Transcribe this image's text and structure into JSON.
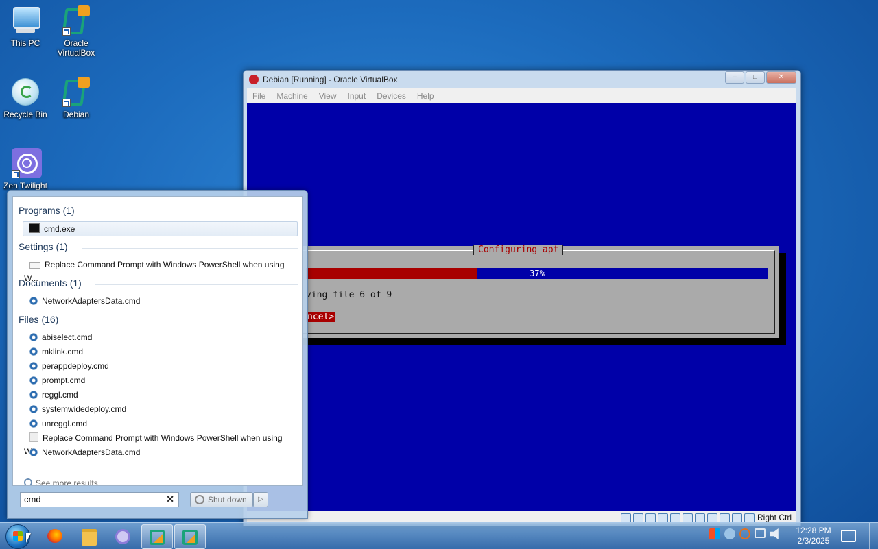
{
  "desktop": {
    "icons": [
      {
        "label": "This PC",
        "icon": "computer-icon"
      },
      {
        "label": "Oracle\nVirtualBox",
        "icon": "virtualbox-icon"
      },
      {
        "label": "Recycle Bin",
        "icon": "recycle-bin-icon"
      },
      {
        "label": "Debian",
        "icon": "virtualbox-icon"
      },
      {
        "label": "Zen Twilight",
        "icon": "zen-browser-icon"
      }
    ]
  },
  "vbox": {
    "title": "Debian [Running] - Oracle VirtualBox",
    "menu": [
      "File",
      "Machine",
      "View",
      "Input",
      "Devices",
      "Help"
    ],
    "host_key": "Right Ctrl",
    "dialog": {
      "title": "Configuring apt",
      "progress_percent": 37,
      "progress_label": "37%",
      "status_line": "ving file 6 of 9",
      "cancel_label": "ncel>"
    }
  },
  "start_menu": {
    "groups": [
      {
        "header": "Programs (1)",
        "items": [
          {
            "label": "cmd.exe",
            "icon": "cmd-icon",
            "selected": true
          }
        ]
      },
      {
        "header": "Settings (1)",
        "items": [
          {
            "label": "Replace Command Prompt with Windows PowerShell when using W...",
            "icon": "settings-icon"
          }
        ]
      },
      {
        "header": "Documents (1)",
        "items": [
          {
            "label": "NetworkAdaptersData.cmd",
            "icon": "script-gear-icon"
          }
        ]
      },
      {
        "header": "Files (16)",
        "items": [
          {
            "label": "abiselect.cmd",
            "icon": "script-gear-icon"
          },
          {
            "label": "mklink.cmd",
            "icon": "script-gear-icon"
          },
          {
            "label": "perappdeploy.cmd",
            "icon": "script-gear-icon"
          },
          {
            "label": "prompt.cmd",
            "icon": "script-gear-icon"
          },
          {
            "label": "reggl.cmd",
            "icon": "script-gear-icon"
          },
          {
            "label": "systemwidedeploy.cmd",
            "icon": "script-gear-icon"
          },
          {
            "label": "unreggl.cmd",
            "icon": "script-gear-icon"
          },
          {
            "label": "Replace Command Prompt with Windows PowerShell when using W...",
            "icon": "document-icon"
          },
          {
            "label": "NetworkAdaptersData.cmd",
            "icon": "script-gear-icon"
          }
        ]
      }
    ],
    "see_more": "See more results",
    "search_value": "cmd",
    "shutdown_label": "Shut down"
  },
  "taskbar": {
    "apps": [
      "firefox-icon",
      "file-explorer-icon",
      "zen-browser-icon",
      "virtualbox-icon",
      "virtualbox-icon"
    ],
    "clock_time": "12:28 PM",
    "clock_date": "2/3/2025"
  },
  "colors": {
    "vm_blue": "#0000a8",
    "vm_red": "#a80000",
    "dialog_gray": "#aaaaaa"
  }
}
